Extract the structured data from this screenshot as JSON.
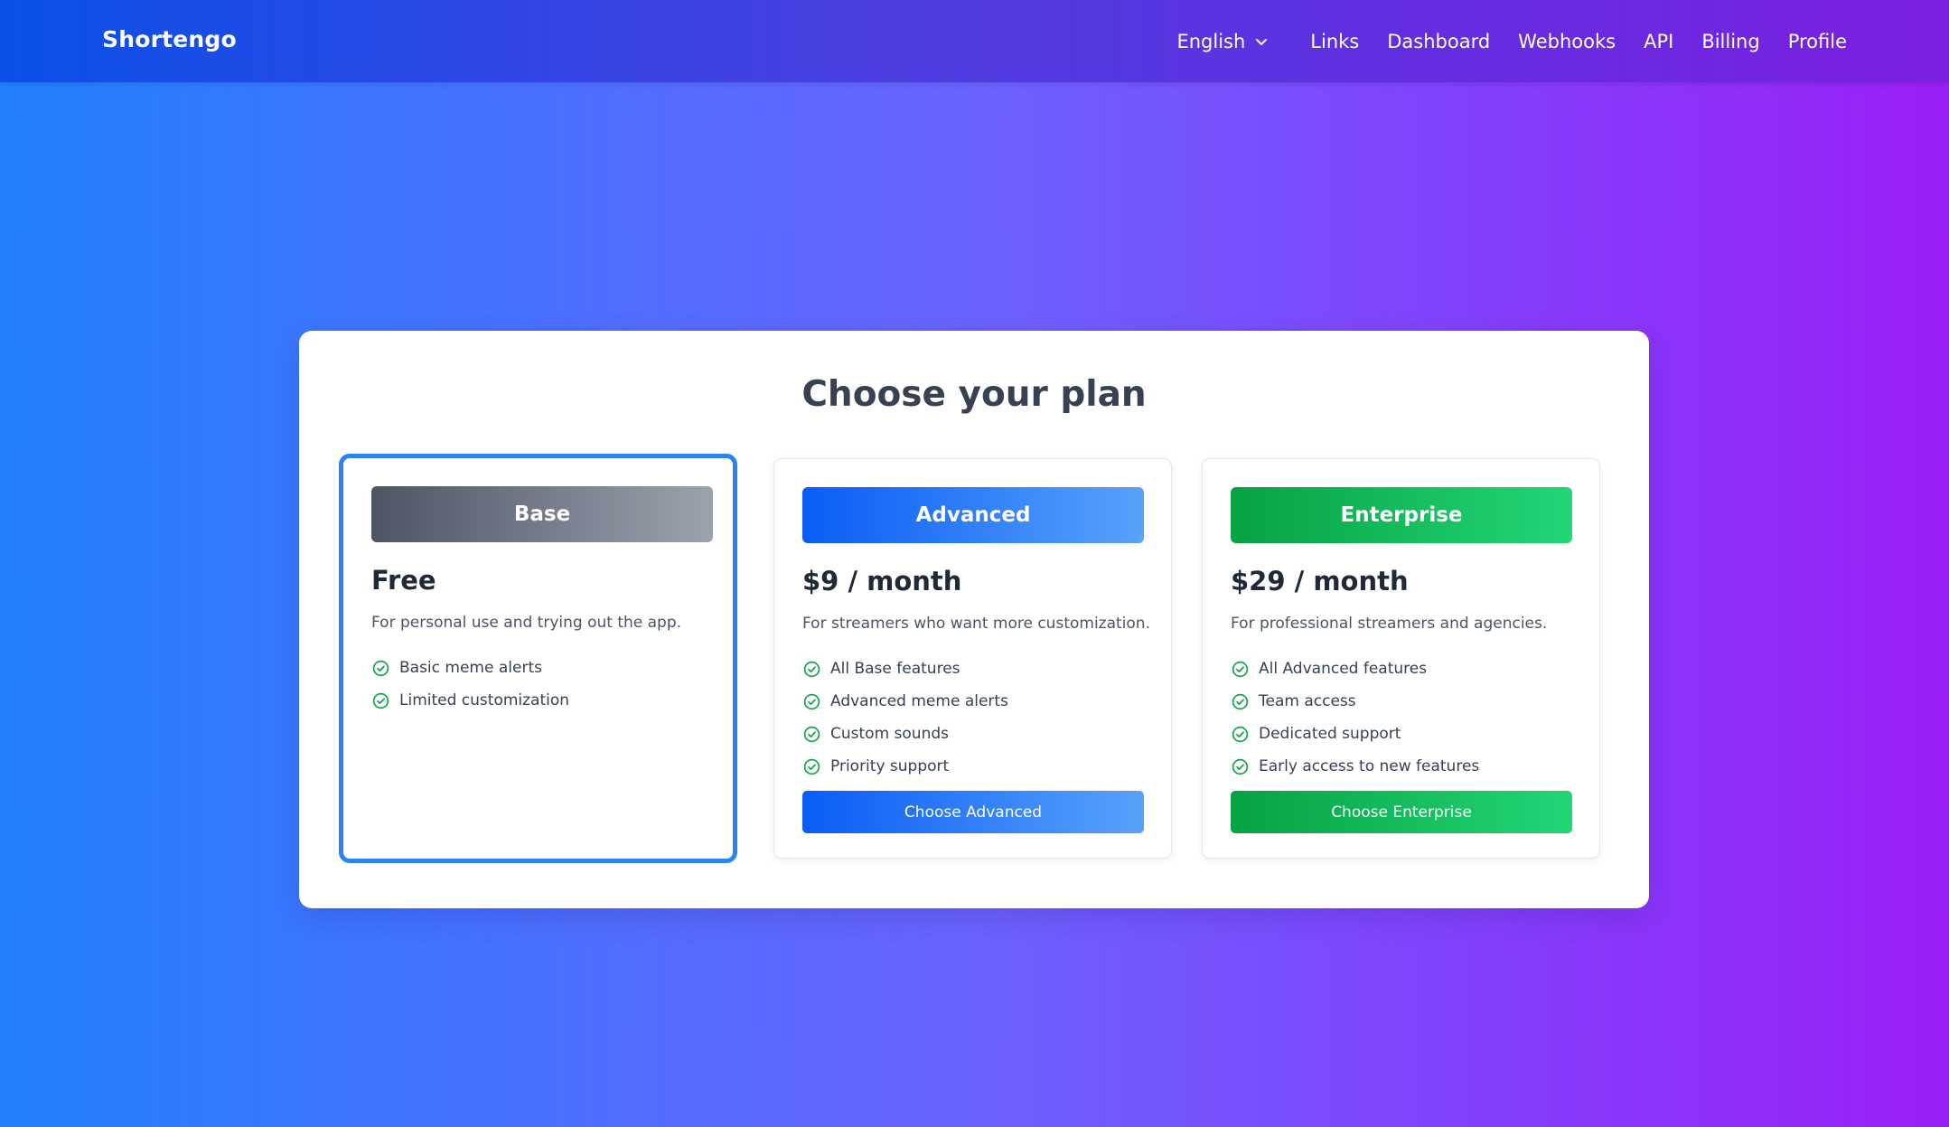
{
  "nav": {
    "brand": "Shortengo",
    "language": "English",
    "links": [
      "Links",
      "Dashboard",
      "Webhooks",
      "API",
      "Billing",
      "Profile"
    ]
  },
  "page": {
    "title": "Choose your plan"
  },
  "plans": [
    {
      "name": "Base",
      "price": "Free",
      "description": "For personal use and trying out the app.",
      "features": [
        "Basic meme alerts",
        "Limited customization"
      ],
      "cta": "",
      "selected": true
    },
    {
      "name": "Advanced",
      "price": "$9 / month",
      "description": "For streamers who want more customization.",
      "features": [
        "All Base features",
        "Advanced meme alerts",
        "Custom sounds",
        "Priority support"
      ],
      "cta": "Choose Advanced",
      "selected": false
    },
    {
      "name": "Enterprise",
      "price": "$29 / month",
      "description": "For professional streamers and agencies.",
      "features": [
        "All Advanced features",
        "Team access",
        "Dedicated support",
        "Early access to new features"
      ],
      "cta": "Choose Enterprise",
      "selected": false
    }
  ],
  "icons": {
    "language_toggle": "chevron-down-icon",
    "feature_marker": "check-circle-icon"
  },
  "colors": {
    "selected_border": "#2b82f2",
    "check_green": "#16a34a",
    "base_gradient": [
      "#4d5563",
      "#9ca3af"
    ],
    "advanced_gradient": [
      "#0a5cf6",
      "#58a2fb"
    ],
    "enterprise_gradient": [
      "#06a243",
      "#23d676"
    ]
  }
}
